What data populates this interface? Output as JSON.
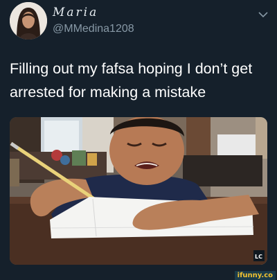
{
  "tweet": {
    "display_name": "Maria",
    "handle": "@MMedina1208",
    "text": "Filling out my fafsa hoping I don’t get arrested for making a mistake",
    "menu_icon": "chevron-down-icon"
  },
  "media": {
    "corner_badge": "LC"
  },
  "watermark": {
    "text": "ifunny.co"
  },
  "colors": {
    "background": "#15202b",
    "secondary_text": "#8899a6",
    "watermark_text": "#f2c230"
  }
}
